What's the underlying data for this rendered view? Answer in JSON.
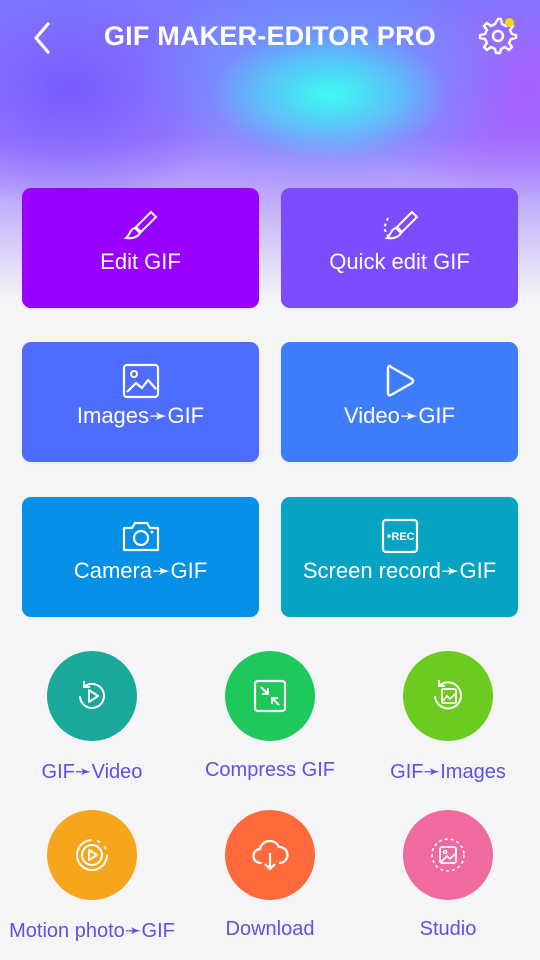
{
  "header": {
    "title": "GIF MAKER-EDITOR PRO"
  },
  "colors": {
    "accent": "#5b53e4",
    "badge": "#ffd400",
    "edit_gif": "#9a00ff",
    "quick_edit_gif": "#7c4dff",
    "images_gif": "#4e6cff",
    "video_gif": "#3f7dff",
    "camera_gif": "#0390e6",
    "screen_record_gif": "#06a3c3"
  },
  "cards": [
    {
      "label": "Edit GIF",
      "icon": "brush-icon"
    },
    {
      "label": "Quick edit GIF",
      "icon": "quick-brush-icon"
    },
    {
      "label": "Images➛GIF",
      "icon": "image-icon"
    },
    {
      "label": "Video➛GIF",
      "icon": "play-icon"
    },
    {
      "label": "Camera➛GIF",
      "icon": "camera-icon"
    },
    {
      "label": "Screen record➛GIF",
      "icon": "rec-icon"
    }
  ],
  "tools": [
    {
      "label": "GIF➛Video",
      "icon": "replay-video-icon",
      "color": "#1aa89a"
    },
    {
      "label": "Compress GIF",
      "icon": "compress-icon",
      "color": "#1ec85b"
    },
    {
      "label": "GIF➛Images",
      "icon": "replay-image-icon",
      "color": "#6ccb1f"
    },
    {
      "label": "Motion photo➛GIF",
      "icon": "motion-play-icon",
      "color": "#f7a51d"
    },
    {
      "label": "Download",
      "icon": "cloud-download-icon",
      "color": "#ff6a3c"
    },
    {
      "label": "Studio",
      "icon": "studio-icon",
      "color": "#f06aa0"
    }
  ]
}
